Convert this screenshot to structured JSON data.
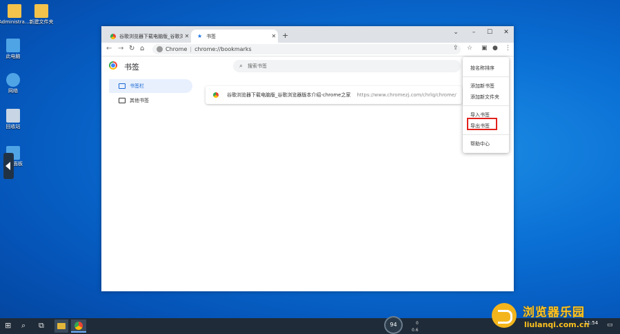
{
  "desktop": {
    "icons": [
      {
        "label": "Administrato...",
        "color": "#f3c34b"
      },
      {
        "label": "新建文件夹",
        "color": "#f3c34b"
      },
      {
        "label": "此电脑",
        "color": "#4fa4e6"
      },
      {
        "label": "网络",
        "color": "#4fa4e6"
      },
      {
        "label": "回收站",
        "color": "#c7d5e4"
      },
      {
        "label": "控制面板",
        "color": "#4fa4e6"
      }
    ]
  },
  "browser": {
    "tabs": [
      {
        "title": "谷歌浏览器下载电脑版_谷歌浏览",
        "active": false
      },
      {
        "title": "书签",
        "active": true
      }
    ],
    "address": {
      "site_label": "Chrome",
      "url": "chrome://bookmarks"
    }
  },
  "bookmarks": {
    "page_title": "书签",
    "search_placeholder": "搜索书签",
    "folders": [
      {
        "label": "书签栏",
        "selected": true
      },
      {
        "label": "其他书签",
        "selected": false
      }
    ],
    "items": [
      {
        "name": "谷歌浏览器下载电脑版_谷歌浏览器版本介绍-chrome之家",
        "url": "https://www.chromezj.com/chrlq/chrome/"
      }
    ]
  },
  "menu": {
    "items": [
      {
        "label": "按名称排序"
      },
      {
        "label": "添加新书签"
      },
      {
        "label": "添加新文件夹"
      },
      {
        "label": "导入书签"
      },
      {
        "label": "导出书签",
        "highlighted": true
      },
      {
        "label": "帮助中心"
      }
    ],
    "highlight_color": "#e2211c"
  },
  "taskbar": {
    "gauge_value": "94",
    "net_up": "0",
    "net_down": "0.6",
    "clock_time": "11:54"
  },
  "watermark": {
    "text": "浏览器乐园",
    "url": "liulanqi.com.cn"
  }
}
